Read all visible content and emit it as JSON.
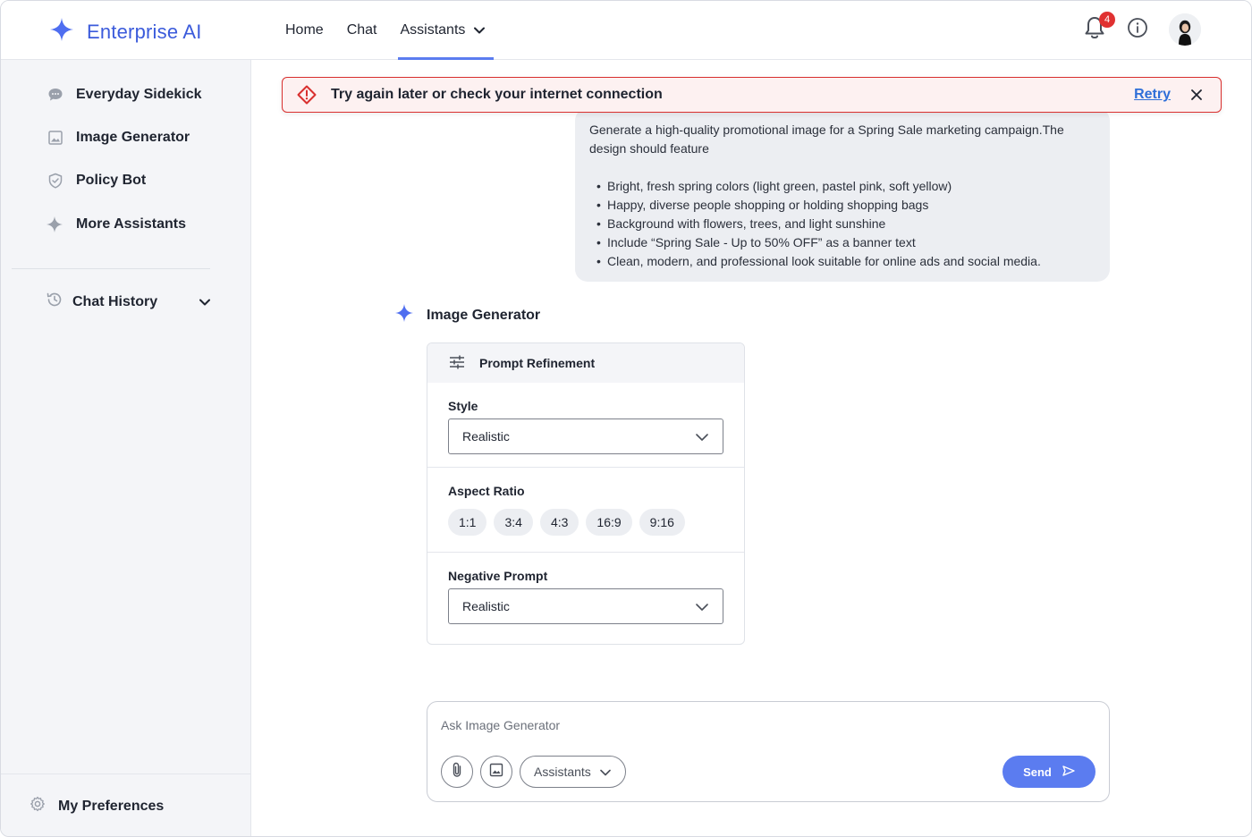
{
  "app": {
    "name": "Enterprise AI",
    "accent": "#5b7cf0",
    "brand_color": "#3b5bdb",
    "danger": "#d9302f"
  },
  "nav": {
    "items": [
      {
        "label": "Home"
      },
      {
        "label": "Chat"
      },
      {
        "label": "Assistants",
        "active": true,
        "has_dropdown": true
      }
    ]
  },
  "header": {
    "notification_count": "4"
  },
  "sidebar": {
    "items": [
      {
        "label": "Everyday Sidekick",
        "icon": "chat-bubble-icon"
      },
      {
        "label": "Image Generator",
        "icon": "image-icon"
      },
      {
        "label": "Policy Bot",
        "icon": "shield-check-icon"
      },
      {
        "label": "More Assistants",
        "icon": "sparkle-icon"
      }
    ],
    "history_label": "Chat History",
    "preferences_label": "My Preferences"
  },
  "alert": {
    "message": "Try again later or check your internet connection",
    "action": "Retry"
  },
  "user_message": {
    "intro": "Generate a high-quality promotional image for a Spring Sale marketing campaign.The design should feature",
    "bullets": [
      "Bright, fresh spring colors (light green, pastel pink, soft yellow)",
      "Happy, diverse people shopping or holding shopping bags",
      "Background with flowers, trees, and light sunshine",
      "Include “Spring Sale - Up to 50% OFF” as a banner text",
      "Clean, modern, and professional look suitable for online ads and social media."
    ]
  },
  "assistant": {
    "name": "Image Generator",
    "card": {
      "title": "Prompt Refinement",
      "style": {
        "label": "Style",
        "value": "Realistic"
      },
      "aspect_ratio": {
        "label": "Aspect Ratio",
        "options": [
          "1:1",
          "3:4",
          "4:3",
          "16:9",
          "9:16"
        ]
      },
      "negative_prompt": {
        "label": "Negative Prompt",
        "value": "Realistic"
      }
    }
  },
  "composer": {
    "placeholder": "Ask Image Generator",
    "assistants_label": "Assistants",
    "send_label": "Send"
  }
}
